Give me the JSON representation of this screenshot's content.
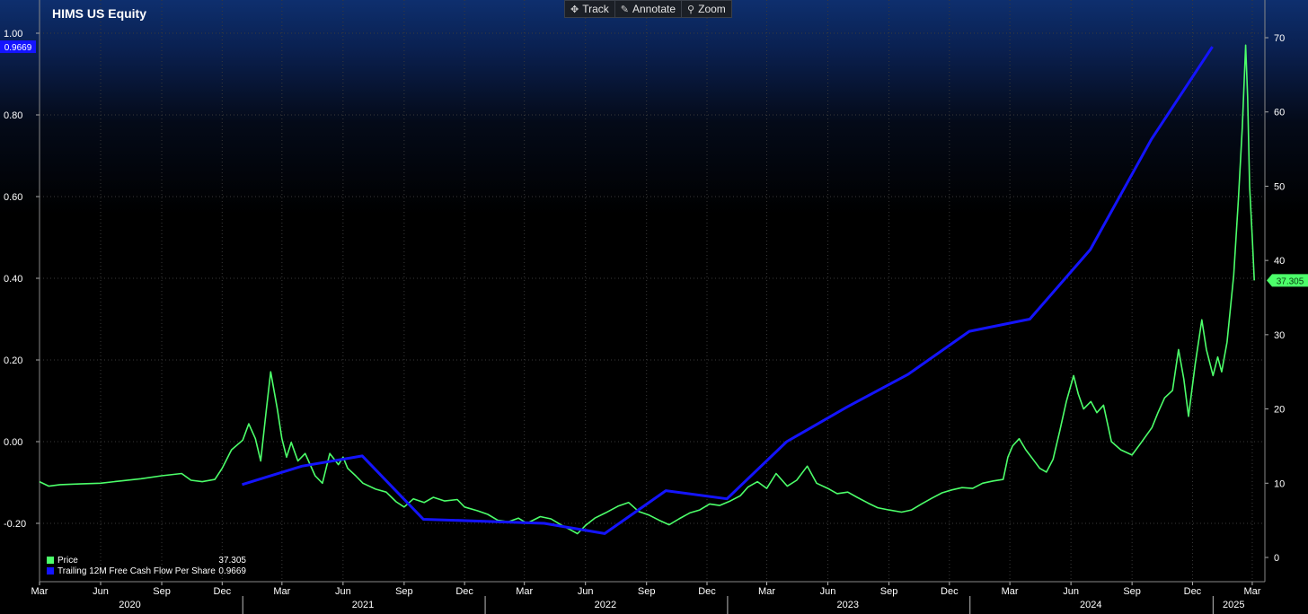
{
  "toolbar": {
    "items": [
      {
        "label": "Track",
        "icon": "crosshair-icon"
      },
      {
        "label": "Annotate",
        "icon": "pencil-icon"
      },
      {
        "label": "Zoom",
        "icon": "magnifier-icon"
      }
    ]
  },
  "chart_data": {
    "type": "line",
    "title": "HIMS US Equity",
    "left_axis": {
      "min": -0.3,
      "max": 1.0,
      "ticks": [
        -0.2,
        0.0,
        0.2,
        0.4,
        0.6,
        0.8,
        1.0
      ],
      "tick_labels": [
        "-0.20",
        "0.00",
        "0.20",
        "0.40",
        "0.60",
        "0.80",
        "1.00"
      ],
      "badge": "0.9669"
    },
    "right_axis": {
      "min": 0,
      "max": 72,
      "ticks": [
        0,
        10,
        20,
        30,
        40,
        50,
        60,
        70
      ],
      "tick_labels": [
        "0",
        "10",
        "20",
        "30",
        "40",
        "50",
        "60",
        "70"
      ],
      "badge": "37.305"
    },
    "x_range": [
      "2020-03-01",
      "2025-03-20"
    ],
    "month_ticks": [
      {
        "date": "2020-03-01",
        "label": "Mar"
      },
      {
        "date": "2020-06-01",
        "label": "Jun"
      },
      {
        "date": "2020-09-01",
        "label": "Sep"
      },
      {
        "date": "2020-12-01",
        "label": "Dec"
      },
      {
        "date": "2021-03-01",
        "label": "Mar"
      },
      {
        "date": "2021-06-01",
        "label": "Jun"
      },
      {
        "date": "2021-09-01",
        "label": "Sep"
      },
      {
        "date": "2021-12-01",
        "label": "Dec"
      },
      {
        "date": "2022-03-01",
        "label": "Mar"
      },
      {
        "date": "2022-06-01",
        "label": "Jun"
      },
      {
        "date": "2022-09-01",
        "label": "Sep"
      },
      {
        "date": "2022-12-01",
        "label": "Dec"
      },
      {
        "date": "2023-03-01",
        "label": "Mar"
      },
      {
        "date": "2023-06-01",
        "label": "Jun"
      },
      {
        "date": "2023-09-01",
        "label": "Sep"
      },
      {
        "date": "2023-12-01",
        "label": "Dec"
      },
      {
        "date": "2024-03-01",
        "label": "Mar"
      },
      {
        "date": "2024-06-01",
        "label": "Jun"
      },
      {
        "date": "2024-09-01",
        "label": "Sep"
      },
      {
        "date": "2024-12-01",
        "label": "Dec"
      },
      {
        "date": "2025-03-01",
        "label": "Mar"
      }
    ],
    "year_labels": [
      {
        "date": "2020-07-15",
        "label": "2020"
      },
      {
        "date": "2021-07-01",
        "label": "2021"
      },
      {
        "date": "2022-07-01",
        "label": "2022"
      },
      {
        "date": "2023-07-01",
        "label": "2023"
      },
      {
        "date": "2024-07-01",
        "label": "2024"
      },
      {
        "date": "2025-02-01",
        "label": "2025"
      }
    ],
    "year_separators": [
      "2021-01-01",
      "2022-01-01",
      "2023-01-01",
      "2024-01-01",
      "2025-01-01"
    ],
    "grid": true,
    "legend_position": "bottom-left",
    "series": [
      {
        "name": "Price",
        "axis": "right",
        "color": "#4cff6a",
        "last_value": "37.305",
        "points": [
          [
            "2020-03-01",
            10.2
          ],
          [
            "2020-03-15",
            9.6
          ],
          [
            "2020-04-01",
            9.8
          ],
          [
            "2020-05-01",
            9.9
          ],
          [
            "2020-06-01",
            10.0
          ],
          [
            "2020-07-01",
            10.3
          ],
          [
            "2020-08-01",
            10.6
          ],
          [
            "2020-09-01",
            11.0
          ],
          [
            "2020-10-01",
            11.3
          ],
          [
            "2020-10-15",
            10.4
          ],
          [
            "2020-11-01",
            10.2
          ],
          [
            "2020-11-20",
            10.5
          ],
          [
            "2020-12-01",
            12.0
          ],
          [
            "2020-12-15",
            14.5
          ],
          [
            "2021-01-01",
            15.8
          ],
          [
            "2021-01-10",
            18.0
          ],
          [
            "2021-01-20",
            16.0
          ],
          [
            "2021-01-28",
            13.0
          ],
          [
            "2021-02-05",
            19.5
          ],
          [
            "2021-02-12",
            25.0
          ],
          [
            "2021-02-22",
            20.0
          ],
          [
            "2021-03-01",
            16.0
          ],
          [
            "2021-03-08",
            13.5
          ],
          [
            "2021-03-15",
            15.5
          ],
          [
            "2021-03-25",
            13.0
          ],
          [
            "2021-04-05",
            14.0
          ],
          [
            "2021-04-20",
            11.0
          ],
          [
            "2021-05-01",
            10.0
          ],
          [
            "2021-05-12",
            14.0
          ],
          [
            "2021-05-25",
            12.5
          ],
          [
            "2021-06-01",
            13.5
          ],
          [
            "2021-06-08",
            12.0
          ],
          [
            "2021-06-20",
            11.0
          ],
          [
            "2021-07-01",
            10.0
          ],
          [
            "2021-07-20",
            9.2
          ],
          [
            "2021-08-05",
            8.8
          ],
          [
            "2021-08-20",
            7.5
          ],
          [
            "2021-09-01",
            6.8
          ],
          [
            "2021-09-15",
            7.9
          ],
          [
            "2021-10-01",
            7.4
          ],
          [
            "2021-10-15",
            8.1
          ],
          [
            "2021-11-01",
            7.6
          ],
          [
            "2021-11-20",
            7.8
          ],
          [
            "2021-12-01",
            6.8
          ],
          [
            "2021-12-20",
            6.3
          ],
          [
            "2022-01-05",
            5.8
          ],
          [
            "2022-01-20",
            5.0
          ],
          [
            "2022-02-05",
            4.8
          ],
          [
            "2022-02-20",
            5.3
          ],
          [
            "2022-03-05",
            4.6
          ],
          [
            "2022-03-25",
            5.5
          ],
          [
            "2022-04-10",
            5.2
          ],
          [
            "2022-04-25",
            4.4
          ],
          [
            "2022-05-10",
            3.7
          ],
          [
            "2022-05-20",
            3.2
          ],
          [
            "2022-06-01",
            4.3
          ],
          [
            "2022-06-15",
            5.3
          ],
          [
            "2022-07-01",
            6.0
          ],
          [
            "2022-07-20",
            6.9
          ],
          [
            "2022-08-05",
            7.4
          ],
          [
            "2022-08-20",
            6.2
          ],
          [
            "2022-09-05",
            5.7
          ],
          [
            "2022-09-20",
            5.0
          ],
          [
            "2022-10-05",
            4.4
          ],
          [
            "2022-10-20",
            5.2
          ],
          [
            "2022-11-05",
            6.0
          ],
          [
            "2022-11-20",
            6.4
          ],
          [
            "2022-12-05",
            7.2
          ],
          [
            "2022-12-20",
            7.0
          ],
          [
            "2023-01-05",
            7.6
          ],
          [
            "2023-01-20",
            8.3
          ],
          [
            "2023-02-01",
            9.5
          ],
          [
            "2023-02-15",
            10.2
          ],
          [
            "2023-03-01",
            9.3
          ],
          [
            "2023-03-15",
            11.3
          ],
          [
            "2023-04-01",
            9.6
          ],
          [
            "2023-04-15",
            10.4
          ],
          [
            "2023-05-01",
            12.3
          ],
          [
            "2023-05-15",
            10.0
          ],
          [
            "2023-06-01",
            9.3
          ],
          [
            "2023-06-15",
            8.6
          ],
          [
            "2023-07-01",
            8.8
          ],
          [
            "2023-07-15",
            8.1
          ],
          [
            "2023-08-01",
            7.3
          ],
          [
            "2023-08-15",
            6.7
          ],
          [
            "2023-09-01",
            6.4
          ],
          [
            "2023-09-20",
            6.1
          ],
          [
            "2023-10-05",
            6.4
          ],
          [
            "2023-10-20",
            7.2
          ],
          [
            "2023-11-05",
            8.0
          ],
          [
            "2023-11-20",
            8.7
          ],
          [
            "2023-12-05",
            9.1
          ],
          [
            "2023-12-20",
            9.4
          ],
          [
            "2024-01-05",
            9.3
          ],
          [
            "2024-01-20",
            10.0
          ],
          [
            "2024-02-05",
            10.3
          ],
          [
            "2024-02-20",
            10.5
          ],
          [
            "2024-02-27",
            13.5
          ],
          [
            "2024-03-05",
            15.0
          ],
          [
            "2024-03-15",
            16.0
          ],
          [
            "2024-03-25",
            14.5
          ],
          [
            "2024-04-05",
            13.2
          ],
          [
            "2024-04-15",
            12.0
          ],
          [
            "2024-04-25",
            11.5
          ],
          [
            "2024-05-05",
            13.2
          ],
          [
            "2024-05-15",
            17.0
          ],
          [
            "2024-05-25",
            21.0
          ],
          [
            "2024-06-05",
            24.5
          ],
          [
            "2024-06-12",
            22.0
          ],
          [
            "2024-06-20",
            20.0
          ],
          [
            "2024-07-01",
            21.0
          ],
          [
            "2024-07-10",
            19.5
          ],
          [
            "2024-07-20",
            20.5
          ],
          [
            "2024-08-01",
            15.6
          ],
          [
            "2024-08-15",
            14.5
          ],
          [
            "2024-09-01",
            13.8
          ],
          [
            "2024-09-15",
            15.5
          ],
          [
            "2024-10-01",
            17.5
          ],
          [
            "2024-10-10",
            19.5
          ],
          [
            "2024-10-20",
            21.5
          ],
          [
            "2024-11-01",
            22.5
          ],
          [
            "2024-11-10",
            28.0
          ],
          [
            "2024-11-18",
            24.0
          ],
          [
            "2024-11-25",
            19.0
          ],
          [
            "2024-12-05",
            26.0
          ],
          [
            "2024-12-15",
            32.0
          ],
          [
            "2024-12-22",
            28.0
          ],
          [
            "2025-01-01",
            24.5
          ],
          [
            "2025-01-08",
            27.0
          ],
          [
            "2025-01-14",
            25.0
          ],
          [
            "2025-01-22",
            29.0
          ],
          [
            "2025-02-01",
            38.0
          ],
          [
            "2025-02-08",
            48.0
          ],
          [
            "2025-02-14",
            58.0
          ],
          [
            "2025-02-19",
            69.0
          ],
          [
            "2025-02-22",
            62.0
          ],
          [
            "2025-02-25",
            50.0
          ],
          [
            "2025-03-01",
            43.0
          ],
          [
            "2025-03-04",
            37.305
          ]
        ]
      },
      {
        "name": "Trailing 12M Free Cash Flow Per Share",
        "axis": "left",
        "color": "#1414ff",
        "last_value": "0.9669",
        "points": [
          [
            "2020-12-31",
            -0.105
          ],
          [
            "2021-03-31",
            -0.06
          ],
          [
            "2021-06-30",
            -0.035
          ],
          [
            "2021-09-30",
            -0.19
          ],
          [
            "2021-12-31",
            -0.195
          ],
          [
            "2022-03-31",
            -0.2
          ],
          [
            "2022-06-30",
            -0.225
          ],
          [
            "2022-09-30",
            -0.12
          ],
          [
            "2022-12-31",
            -0.14
          ],
          [
            "2023-03-31",
            0.0
          ],
          [
            "2023-06-30",
            0.085
          ],
          [
            "2023-09-30",
            0.165
          ],
          [
            "2023-12-31",
            0.27
          ],
          [
            "2024-03-31",
            0.3
          ],
          [
            "2024-06-30",
            0.47
          ],
          [
            "2024-09-30",
            0.74
          ],
          [
            "2024-12-31",
            0.9669
          ]
        ]
      }
    ]
  }
}
